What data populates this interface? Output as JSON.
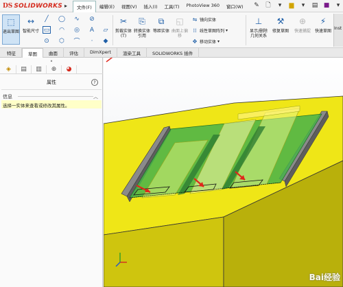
{
  "app": {
    "brand": "SOLIDWORKS",
    "brand_prefix": "DS"
  },
  "menu": [
    "文件(F)",
    "编辑(E)",
    "视图(V)",
    "插入(I)",
    "工具(T)",
    "PhotoView 360",
    "窗口(W)"
  ],
  "ribbon": {
    "exit_sketch": "退出草图",
    "smart_dim": "智能尺寸",
    "trim": "剪裁实体(T)",
    "convert": "转换实体引用",
    "offset": "等距实体",
    "surface": "曲面上偏移",
    "mirror": "镜向实体",
    "linear_pattern": "线性草图阵列",
    "move": "移动实体",
    "relations": "显示/删除几何关系",
    "repair": "修复草图",
    "quick_snaps": "快速捕捉",
    "instant": "快速草图",
    "inst": "Inst"
  },
  "tabs": [
    "特征",
    "草图",
    "曲面",
    "评估",
    "DimXpert",
    "渲染工具",
    "SOLIDWORKS 插件"
  ],
  "active_tab": "草图",
  "panel": {
    "title": "属性",
    "section": "信息",
    "message": "选择一实体来查看或修改其属性。"
  },
  "watermark": "Bai经验",
  "colors": {
    "accent_red": "#d52b1e",
    "block_yellow": "#f2ea18",
    "sketch_green": "#3ea53e",
    "highlight": "#ffffc8"
  }
}
